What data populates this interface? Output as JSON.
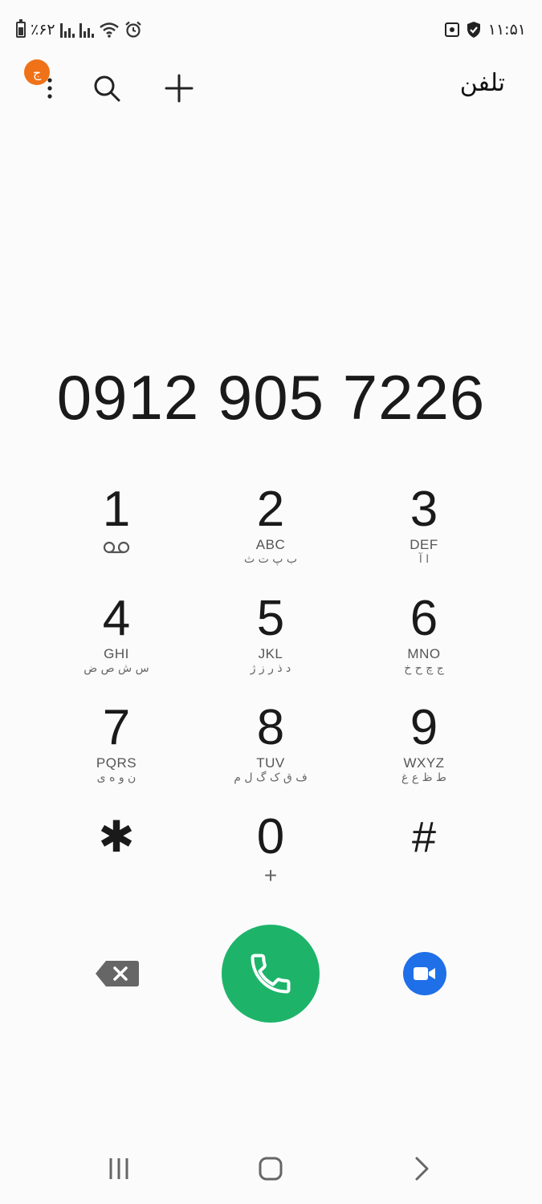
{
  "status_bar": {
    "battery_text": "٪۶۲",
    "time": "۱۱:۵۱"
  },
  "app": {
    "title": "تلفن",
    "badge_letter": "ج"
  },
  "dialer": {
    "number": "0912 905 7226"
  },
  "keypad": [
    {
      "digit": "1",
      "letters": "",
      "persian": "",
      "voicemail": true
    },
    {
      "digit": "2",
      "letters": "ABC",
      "persian": "ب پ ت ث"
    },
    {
      "digit": "3",
      "letters": "DEF",
      "persian": "ا آ"
    },
    {
      "digit": "4",
      "letters": "GHI",
      "persian": "س ش ص ض"
    },
    {
      "digit": "5",
      "letters": "JKL",
      "persian": "د ذ ر ز ژ"
    },
    {
      "digit": "6",
      "letters": "MNO",
      "persian": "ج چ ح خ"
    },
    {
      "digit": "7",
      "letters": "PQRS",
      "persian": "ن و ه ی"
    },
    {
      "digit": "8",
      "letters": "TUV",
      "persian": "ف ق ک گ ل م"
    },
    {
      "digit": "9",
      "letters": "WXYZ",
      "persian": "ط ظ ع غ"
    },
    {
      "digit": "✱",
      "letters": "",
      "persian": ""
    },
    {
      "digit": "0",
      "letters": "",
      "persian": "",
      "sub": "+"
    },
    {
      "digit": "#",
      "letters": "",
      "persian": ""
    }
  ],
  "colors": {
    "call": "#1db46a",
    "video": "#1f6fe8",
    "badge": "#f07218",
    "background": "#fbfbfb"
  },
  "icons": {
    "backspace": "backspace-icon",
    "call": "phone-icon",
    "video": "video-call-icon",
    "search": "search-icon",
    "add": "plus-icon",
    "more": "more-vertical-icon"
  }
}
